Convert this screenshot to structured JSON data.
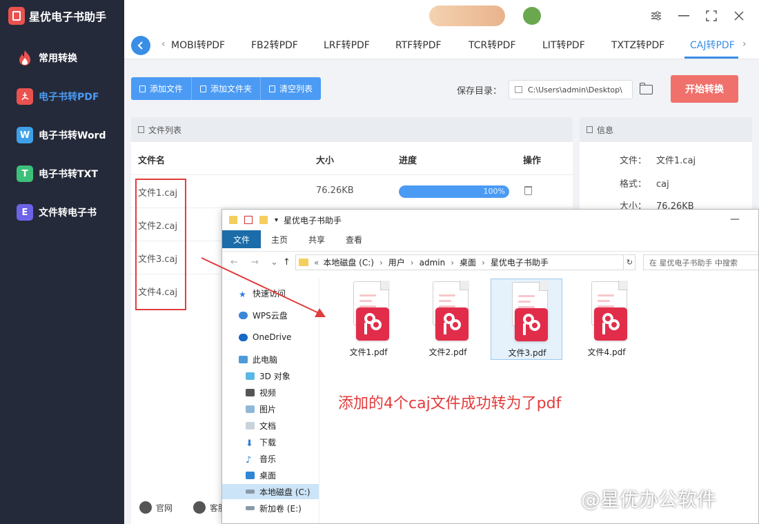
{
  "app": {
    "name": "星优电子书助手"
  },
  "sidebar": {
    "items": [
      {
        "label": "常用转换",
        "icon": "flame-icon",
        "color": "#e9524f"
      },
      {
        "label": "电子书转PDF",
        "icon": "pdf-icon",
        "color": "#e9524f",
        "letter": "",
        "active": true
      },
      {
        "label": "电子书转Word",
        "icon": "word-icon",
        "color": "#3ea1e8",
        "letter": "W"
      },
      {
        "label": "电子书转TXT",
        "icon": "txt-icon",
        "color": "#3dc07a",
        "letter": "T"
      },
      {
        "label": "文件转电子书",
        "icon": "ebook-icon",
        "color": "#6d63e8",
        "letter": "E"
      }
    ]
  },
  "tabs": {
    "items": [
      "MOBI转PDF",
      "FB2转PDF",
      "LRF转PDF",
      "RTF转PDF",
      "TCR转PDF",
      "LIT转PDF",
      "TXTZ转PDF",
      "CAJ转PDF"
    ],
    "active_index": 7
  },
  "toolbar": {
    "add_file": "添加文件",
    "add_folder": "添加文件夹",
    "clear_list": "清空列表",
    "save_label": "保存目录：",
    "save_path": "C:\\Users\\admin\\Desktop\\",
    "start": "开始转换"
  },
  "file_list": {
    "title": "文件列表",
    "columns": [
      "文件名",
      "大小",
      "进度",
      "操作"
    ],
    "rows": [
      {
        "name": "文件1.caj",
        "size": "76.26KB",
        "progress_pct": 100,
        "progress_text": "100%"
      },
      {
        "name": "文件2.caj"
      },
      {
        "name": "文件3.caj"
      },
      {
        "name": "文件4.caj"
      }
    ]
  },
  "info": {
    "title": "信息",
    "file_label": "文件：",
    "file_value": "文件1.caj",
    "format_label": "格式：",
    "format_value": "caj",
    "size_label": "大小：",
    "size_value": "76.26KB"
  },
  "footer": {
    "website": "官网",
    "service": "客服"
  },
  "explorer": {
    "title": "星优电子书助手",
    "ribbon_tabs": [
      "文件",
      "主页",
      "共享",
      "查看"
    ],
    "path": [
      "本地磁盘 (C:)",
      "用户",
      "admin",
      "桌面",
      "星优电子书助手"
    ],
    "search_placeholder": "在 星优电子书助手 中搜索",
    "tree": [
      {
        "label": "快速访问",
        "icon": "star-icon"
      },
      {
        "label": "WPS云盘",
        "icon": "cloud-icon"
      },
      {
        "label": "OneDrive",
        "icon": "onedrive-icon"
      },
      {
        "label": "此电脑",
        "icon": "computer-icon"
      },
      {
        "label": "3D 对象",
        "icon": "cube-icon"
      },
      {
        "label": "视频",
        "icon": "video-icon"
      },
      {
        "label": "图片",
        "icon": "picture-icon"
      },
      {
        "label": "文档",
        "icon": "document-icon"
      },
      {
        "label": "下载",
        "icon": "download-icon"
      },
      {
        "label": "音乐",
        "icon": "music-icon"
      },
      {
        "label": "桌面",
        "icon": "desktop-icon"
      },
      {
        "label": "本地磁盘 (C:)",
        "icon": "drive-icon",
        "selected": true
      },
      {
        "label": "新加卷 (E:)",
        "icon": "drive-icon"
      }
    ],
    "files": [
      {
        "name": "文件1.pdf"
      },
      {
        "name": "文件2.pdf"
      },
      {
        "name": "文件3.pdf",
        "selected": true
      },
      {
        "name": "文件4.pdf"
      }
    ]
  },
  "annotation": "添加的4个caj文件成功转为了pdf",
  "watermark": "@星优办公软件"
}
